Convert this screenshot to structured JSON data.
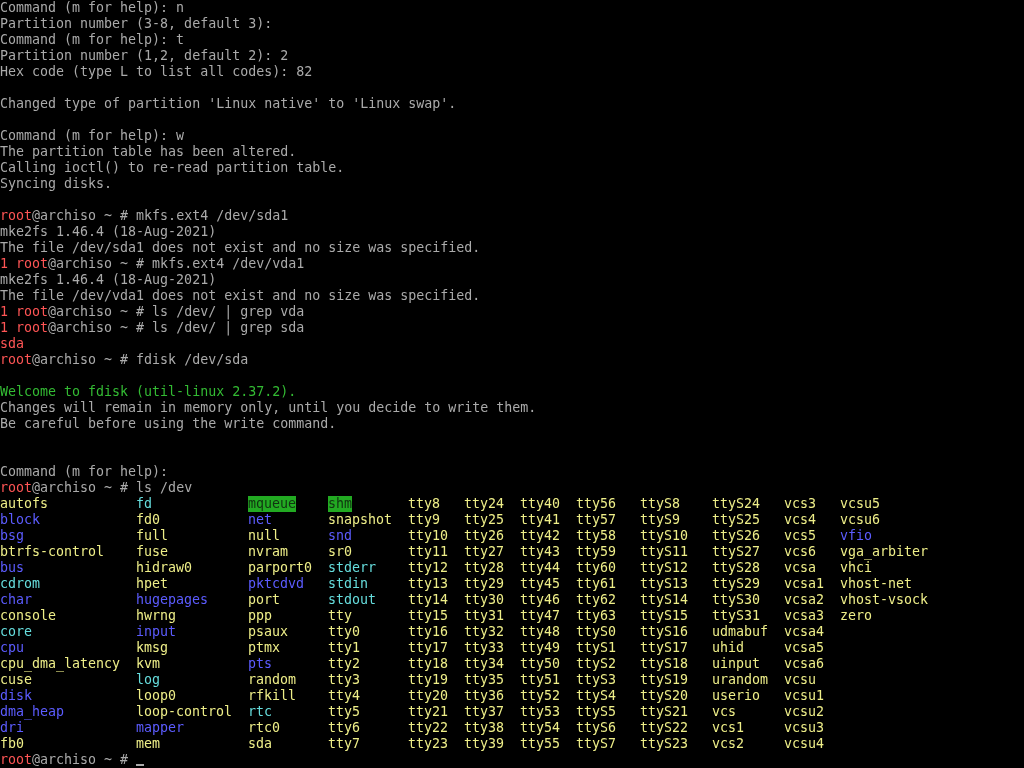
{
  "terminal": {
    "lines": [
      {
        "kind": "text",
        "segments": [
          {
            "text": "Command (m for help): n",
            "color": "#aaaaaa"
          }
        ]
      },
      {
        "kind": "text",
        "segments": [
          {
            "text": "Partition number (3-8, default 3):",
            "color": "#aaaaaa"
          }
        ]
      },
      {
        "kind": "text",
        "segments": [
          {
            "text": "Command (m for help): t",
            "color": "#aaaaaa"
          }
        ]
      },
      {
        "kind": "text",
        "segments": [
          {
            "text": "Partition number (1,2, default 2): 2",
            "color": "#aaaaaa"
          }
        ]
      },
      {
        "kind": "text",
        "segments": [
          {
            "text": "Hex code (type L to list all codes): 82",
            "color": "#aaaaaa"
          }
        ]
      },
      {
        "kind": "blank"
      },
      {
        "kind": "text",
        "segments": [
          {
            "text": "Changed type of partition 'Linux native' to 'Linux swap'.",
            "color": "#aaaaaa"
          }
        ]
      },
      {
        "kind": "blank"
      },
      {
        "kind": "text",
        "segments": [
          {
            "text": "Command (m for help): w",
            "color": "#aaaaaa"
          }
        ]
      },
      {
        "kind": "text",
        "segments": [
          {
            "text": "The partition table has been altered.",
            "color": "#aaaaaa"
          }
        ]
      },
      {
        "kind": "text",
        "segments": [
          {
            "text": "Calling ioctl() to re-read partition table.",
            "color": "#aaaaaa"
          }
        ]
      },
      {
        "kind": "text",
        "segments": [
          {
            "text": "Syncing disks.",
            "color": "#aaaaaa"
          }
        ]
      },
      {
        "kind": "blank"
      },
      {
        "kind": "text",
        "segments": [
          {
            "text": "root",
            "color": "#ff5555"
          },
          {
            "text": "@archiso ~ # mkfs.ext4 /dev/sda1",
            "color": "#aaaaaa"
          }
        ]
      },
      {
        "kind": "text",
        "segments": [
          {
            "text": "mke2fs 1.46.4 (18-Aug-2021)",
            "color": "#aaaaaa"
          }
        ]
      },
      {
        "kind": "text",
        "segments": [
          {
            "text": "The file /dev/sda1 does not exist and no size was specified.",
            "color": "#aaaaaa"
          }
        ]
      },
      {
        "kind": "text",
        "segments": [
          {
            "text": "1 root",
            "color": "#ff5555"
          },
          {
            "text": "@archiso ~ # mkfs.ext4 /dev/vda1",
            "color": "#aaaaaa"
          }
        ]
      },
      {
        "kind": "text",
        "segments": [
          {
            "text": "mke2fs 1.46.4 (18-Aug-2021)",
            "color": "#aaaaaa"
          }
        ]
      },
      {
        "kind": "text",
        "segments": [
          {
            "text": "The file /dev/vda1 does not exist and no size was specified.",
            "color": "#aaaaaa"
          }
        ]
      },
      {
        "kind": "text",
        "segments": [
          {
            "text": "1 root",
            "color": "#ff5555"
          },
          {
            "text": "@archiso ~ # ls /dev/ | grep vda",
            "color": "#aaaaaa"
          }
        ]
      },
      {
        "kind": "text",
        "segments": [
          {
            "text": "1 root",
            "color": "#ff5555"
          },
          {
            "text": "@archiso ~ # ls /dev/ | grep sda",
            "color": "#aaaaaa"
          }
        ]
      },
      {
        "kind": "text",
        "segments": [
          {
            "text": "sda",
            "color": "#ff5555"
          }
        ]
      },
      {
        "kind": "text",
        "segments": [
          {
            "text": "root",
            "color": "#ff5555"
          },
          {
            "text": "@archiso ~ # fdisk /dev/sda",
            "color": "#aaaaaa"
          }
        ]
      },
      {
        "kind": "blank"
      },
      {
        "kind": "text",
        "segments": [
          {
            "text": "Welcome to fdisk (util-linux 2.37.2).",
            "color": "#33bb33"
          }
        ]
      },
      {
        "kind": "text",
        "segments": [
          {
            "text": "Changes will remain in memory only, until you decide to write them.",
            "color": "#aaaaaa"
          }
        ]
      },
      {
        "kind": "text",
        "segments": [
          {
            "text": "Be careful before using the write command.",
            "color": "#aaaaaa"
          }
        ]
      },
      {
        "kind": "blank"
      },
      {
        "kind": "blank"
      },
      {
        "kind": "text",
        "segments": [
          {
            "text": "Command (m for help):",
            "color": "#aaaaaa"
          }
        ]
      },
      {
        "kind": "text",
        "segments": [
          {
            "text": "root",
            "color": "#ff5555"
          },
          {
            "text": "@archiso ~ # ls /dev",
            "color": "#aaaaaa"
          }
        ]
      },
      {
        "kind": "listing",
        "columns": [
          [
            {
              "name": "autofs",
              "kind": "device"
            },
            {
              "name": "block",
              "kind": "dir"
            },
            {
              "name": "bsg",
              "kind": "dir"
            },
            {
              "name": "btrfs-control",
              "kind": "device"
            },
            {
              "name": "bus",
              "kind": "dir"
            },
            {
              "name": "cdrom",
              "kind": "link"
            },
            {
              "name": "char",
              "kind": "dir"
            },
            {
              "name": "console",
              "kind": "device"
            },
            {
              "name": "core",
              "kind": "link"
            },
            {
              "name": "cpu",
              "kind": "dir"
            },
            {
              "name": "cpu_dma_latency",
              "kind": "device"
            },
            {
              "name": "cuse",
              "kind": "device"
            },
            {
              "name": "disk",
              "kind": "dir"
            },
            {
              "name": "dma_heap",
              "kind": "dir"
            },
            {
              "name": "dri",
              "kind": "dir"
            },
            {
              "name": "fb0",
              "kind": "device"
            }
          ],
          [
            {
              "name": "fd",
              "kind": "link"
            },
            {
              "name": "fd0",
              "kind": "device"
            },
            {
              "name": "full",
              "kind": "device"
            },
            {
              "name": "fuse",
              "kind": "device"
            },
            {
              "name": "hidraw0",
              "kind": "device"
            },
            {
              "name": "hpet",
              "kind": "device"
            },
            {
              "name": "hugepages",
              "kind": "dir"
            },
            {
              "name": "hwrng",
              "kind": "device"
            },
            {
              "name": "input",
              "kind": "dir"
            },
            {
              "name": "kmsg",
              "kind": "device"
            },
            {
              "name": "kvm",
              "kind": "device"
            },
            {
              "name": "log",
              "kind": "link"
            },
            {
              "name": "loop0",
              "kind": "device"
            },
            {
              "name": "loop-control",
              "kind": "device"
            },
            {
              "name": "mapper",
              "kind": "dir"
            },
            {
              "name": "mem",
              "kind": "device"
            }
          ],
          [
            {
              "name": "mqueue",
              "kind": "sticky"
            },
            {
              "name": "net",
              "kind": "dir"
            },
            {
              "name": "null",
              "kind": "device"
            },
            {
              "name": "nvram",
              "kind": "device"
            },
            {
              "name": "parport0",
              "kind": "device"
            },
            {
              "name": "pktcdvd",
              "kind": "dir"
            },
            {
              "name": "port",
              "kind": "device"
            },
            {
              "name": "ppp",
              "kind": "device"
            },
            {
              "name": "psaux",
              "kind": "device"
            },
            {
              "name": "ptmx",
              "kind": "device"
            },
            {
              "name": "pts",
              "kind": "dir"
            },
            {
              "name": "random",
              "kind": "device"
            },
            {
              "name": "rfkill",
              "kind": "device"
            },
            {
              "name": "rtc",
              "kind": "link"
            },
            {
              "name": "rtc0",
              "kind": "device"
            },
            {
              "name": "sda",
              "kind": "device"
            }
          ],
          [
            {
              "name": "shm",
              "kind": "sticky"
            },
            {
              "name": "snapshot",
              "kind": "device"
            },
            {
              "name": "snd",
              "kind": "dir"
            },
            {
              "name": "sr0",
              "kind": "device"
            },
            {
              "name": "stderr",
              "kind": "link"
            },
            {
              "name": "stdin",
              "kind": "link"
            },
            {
              "name": "stdout",
              "kind": "link"
            },
            {
              "name": "tty",
              "kind": "device"
            },
            {
              "name": "tty0",
              "kind": "device"
            },
            {
              "name": "tty1",
              "kind": "device"
            },
            {
              "name": "tty2",
              "kind": "device"
            },
            {
              "name": "tty3",
              "kind": "device"
            },
            {
              "name": "tty4",
              "kind": "device"
            },
            {
              "name": "tty5",
              "kind": "device"
            },
            {
              "name": "tty6",
              "kind": "device"
            },
            {
              "name": "tty7",
              "kind": "device"
            }
          ],
          [
            {
              "name": "tty8",
              "kind": "device"
            },
            {
              "name": "tty9",
              "kind": "device"
            },
            {
              "name": "tty10",
              "kind": "device"
            },
            {
              "name": "tty11",
              "kind": "device"
            },
            {
              "name": "tty12",
              "kind": "device"
            },
            {
              "name": "tty13",
              "kind": "device"
            },
            {
              "name": "tty14",
              "kind": "device"
            },
            {
              "name": "tty15",
              "kind": "device"
            },
            {
              "name": "tty16",
              "kind": "device"
            },
            {
              "name": "tty17",
              "kind": "device"
            },
            {
              "name": "tty18",
              "kind": "device"
            },
            {
              "name": "tty19",
              "kind": "device"
            },
            {
              "name": "tty20",
              "kind": "device"
            },
            {
              "name": "tty21",
              "kind": "device"
            },
            {
              "name": "tty22",
              "kind": "device"
            },
            {
              "name": "tty23",
              "kind": "device"
            }
          ],
          [
            {
              "name": "tty24",
              "kind": "device"
            },
            {
              "name": "tty25",
              "kind": "device"
            },
            {
              "name": "tty26",
              "kind": "device"
            },
            {
              "name": "tty27",
              "kind": "device"
            },
            {
              "name": "tty28",
              "kind": "device"
            },
            {
              "name": "tty29",
              "kind": "device"
            },
            {
              "name": "tty30",
              "kind": "device"
            },
            {
              "name": "tty31",
              "kind": "device"
            },
            {
              "name": "tty32",
              "kind": "device"
            },
            {
              "name": "tty33",
              "kind": "device"
            },
            {
              "name": "tty34",
              "kind": "device"
            },
            {
              "name": "tty35",
              "kind": "device"
            },
            {
              "name": "tty36",
              "kind": "device"
            },
            {
              "name": "tty37",
              "kind": "device"
            },
            {
              "name": "tty38",
              "kind": "device"
            },
            {
              "name": "tty39",
              "kind": "device"
            }
          ],
          [
            {
              "name": "tty40",
              "kind": "device"
            },
            {
              "name": "tty41",
              "kind": "device"
            },
            {
              "name": "tty42",
              "kind": "device"
            },
            {
              "name": "tty43",
              "kind": "device"
            },
            {
              "name": "tty44",
              "kind": "device"
            },
            {
              "name": "tty45",
              "kind": "device"
            },
            {
              "name": "tty46",
              "kind": "device"
            },
            {
              "name": "tty47",
              "kind": "device"
            },
            {
              "name": "tty48",
              "kind": "device"
            },
            {
              "name": "tty49",
              "kind": "device"
            },
            {
              "name": "tty50",
              "kind": "device"
            },
            {
              "name": "tty51",
              "kind": "device"
            },
            {
              "name": "tty52",
              "kind": "device"
            },
            {
              "name": "tty53",
              "kind": "device"
            },
            {
              "name": "tty54",
              "kind": "device"
            },
            {
              "name": "tty55",
              "kind": "device"
            }
          ],
          [
            {
              "name": "tty56",
              "kind": "device"
            },
            {
              "name": "tty57",
              "kind": "device"
            },
            {
              "name": "tty58",
              "kind": "device"
            },
            {
              "name": "tty59",
              "kind": "device"
            },
            {
              "name": "tty60",
              "kind": "device"
            },
            {
              "name": "tty61",
              "kind": "device"
            },
            {
              "name": "tty62",
              "kind": "device"
            },
            {
              "name": "tty63",
              "kind": "device"
            },
            {
              "name": "ttyS0",
              "kind": "device"
            },
            {
              "name": "ttyS1",
              "kind": "device"
            },
            {
              "name": "ttyS2",
              "kind": "device"
            },
            {
              "name": "ttyS3",
              "kind": "device"
            },
            {
              "name": "ttyS4",
              "kind": "device"
            },
            {
              "name": "ttyS5",
              "kind": "device"
            },
            {
              "name": "ttyS6",
              "kind": "device"
            },
            {
              "name": "ttyS7",
              "kind": "device"
            }
          ],
          [
            {
              "name": "ttyS8",
              "kind": "device"
            },
            {
              "name": "ttyS9",
              "kind": "device"
            },
            {
              "name": "ttyS10",
              "kind": "device"
            },
            {
              "name": "ttyS11",
              "kind": "device"
            },
            {
              "name": "ttyS12",
              "kind": "device"
            },
            {
              "name": "ttyS13",
              "kind": "device"
            },
            {
              "name": "ttyS14",
              "kind": "device"
            },
            {
              "name": "ttyS15",
              "kind": "device"
            },
            {
              "name": "ttyS16",
              "kind": "device"
            },
            {
              "name": "ttyS17",
              "kind": "device"
            },
            {
              "name": "ttyS18",
              "kind": "device"
            },
            {
              "name": "ttyS19",
              "kind": "device"
            },
            {
              "name": "ttyS20",
              "kind": "device"
            },
            {
              "name": "ttyS21",
              "kind": "device"
            },
            {
              "name": "ttyS22",
              "kind": "device"
            },
            {
              "name": "ttyS23",
              "kind": "device"
            }
          ],
          [
            {
              "name": "ttyS24",
              "kind": "device"
            },
            {
              "name": "ttyS25",
              "kind": "device"
            },
            {
              "name": "ttyS26",
              "kind": "device"
            },
            {
              "name": "ttyS27",
              "kind": "device"
            },
            {
              "name": "ttyS28",
              "kind": "device"
            },
            {
              "name": "ttyS29",
              "kind": "device"
            },
            {
              "name": "ttyS30",
              "kind": "device"
            },
            {
              "name": "ttyS31",
              "kind": "device"
            },
            {
              "name": "udmabuf",
              "kind": "device"
            },
            {
              "name": "uhid",
              "kind": "device"
            },
            {
              "name": "uinput",
              "kind": "device"
            },
            {
              "name": "urandom",
              "kind": "device"
            },
            {
              "name": "userio",
              "kind": "device"
            },
            {
              "name": "vcs",
              "kind": "device"
            },
            {
              "name": "vcs1",
              "kind": "device"
            },
            {
              "name": "vcs2",
              "kind": "device"
            }
          ],
          [
            {
              "name": "vcs3",
              "kind": "device"
            },
            {
              "name": "vcs4",
              "kind": "device"
            },
            {
              "name": "vcs5",
              "kind": "device"
            },
            {
              "name": "vcs6",
              "kind": "device"
            },
            {
              "name": "vcsa",
              "kind": "device"
            },
            {
              "name": "vcsa1",
              "kind": "device"
            },
            {
              "name": "vcsa2",
              "kind": "device"
            },
            {
              "name": "vcsa3",
              "kind": "device"
            },
            {
              "name": "vcsa4",
              "kind": "device"
            },
            {
              "name": "vcsa5",
              "kind": "device"
            },
            {
              "name": "vcsa6",
              "kind": "device"
            },
            {
              "name": "vcsu",
              "kind": "device"
            },
            {
              "name": "vcsu1",
              "kind": "device"
            },
            {
              "name": "vcsu2",
              "kind": "device"
            },
            {
              "name": "vcsu3",
              "kind": "device"
            },
            {
              "name": "vcsu4",
              "kind": "device"
            }
          ],
          [
            {
              "name": "vcsu5",
              "kind": "device"
            },
            {
              "name": "vcsu6",
              "kind": "device"
            },
            {
              "name": "vfio",
              "kind": "dir"
            },
            {
              "name": "vga_arbiter",
              "kind": "device"
            },
            {
              "name": "vhci",
              "kind": "device"
            },
            {
              "name": "vhost-net",
              "kind": "device"
            },
            {
              "name": "vhost-vsock",
              "kind": "device"
            },
            {
              "name": "zero",
              "kind": "device"
            }
          ]
        ]
      },
      {
        "kind": "text",
        "cursor": true,
        "segments": [
          {
            "text": "root",
            "color": "#ff5555"
          },
          {
            "text": "@archiso ~ #",
            "color": "#aaaaaa"
          }
        ]
      }
    ]
  }
}
